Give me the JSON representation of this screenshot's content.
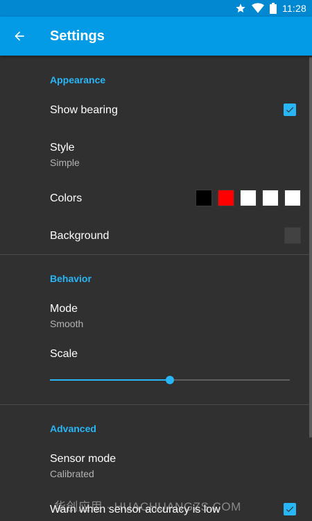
{
  "status_bar": {
    "time": "11:28",
    "icons": [
      "star-icon",
      "wifi-icon",
      "battery-icon"
    ]
  },
  "app_bar": {
    "title": "Settings",
    "back_icon": "arrow-back-icon"
  },
  "colors": {
    "primary": "#039be5",
    "primary_dark": "#0288d1",
    "accent": "#29b6f6",
    "background": "#303030"
  },
  "sections": {
    "appearance": {
      "header": "Appearance",
      "show_bearing": {
        "title": "Show bearing",
        "checked": true
      },
      "style": {
        "title": "Style",
        "summary": "Simple"
      },
      "colors": {
        "title": "Colors",
        "swatches": [
          "#000000",
          "#ff0000",
          "#ffffff",
          "#ffffff",
          "#ffffff"
        ]
      },
      "background": {
        "title": "Background",
        "swatch": "#424242"
      }
    },
    "behavior": {
      "header": "Behavior",
      "mode": {
        "title": "Mode",
        "summary": "Smooth"
      },
      "scale": {
        "title": "Scale",
        "value_fraction": 0.5
      }
    },
    "advanced": {
      "header": "Advanced",
      "sensor_mode": {
        "title": "Sensor mode",
        "summary": "Calibrated"
      },
      "warn_accuracy": {
        "title": "Warn when sensor accuracy is low",
        "checked": true
      }
    }
  },
  "watermark": "华创应用 · HUACHUANGZS.COM"
}
